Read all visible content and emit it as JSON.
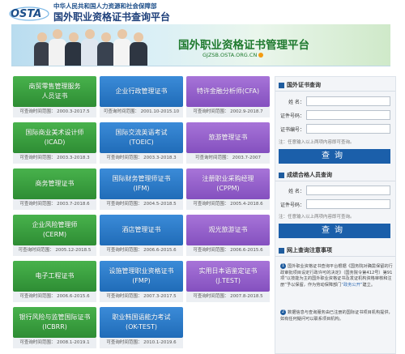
{
  "header": {
    "logo_text": "OSTA",
    "ministry": "中华人民共和国人力资源和社会保障部",
    "site_title": "国外职业资格证书查询平台"
  },
  "banner": {
    "title": "国外职业资格证书管理平台",
    "url": "GJZSB.OSTA.ORG.CN"
  },
  "certificates": [
    {
      "name_lines": [
        "商贸零售管理服务",
        "人员证书"
      ],
      "range": "可查询时间范围： 2000.3-2017.5",
      "color": "green"
    },
    {
      "name_lines": [
        "企业行政管理证书"
      ],
      "range": "可查询时间范围： 2001.10-2015.10",
      "color": "blue"
    },
    {
      "name_lines": [
        "特许金融分析师(CFA)"
      ],
      "range": "可查询时间范围： 2002.9-2018.7",
      "color": "purple"
    },
    {
      "name_lines": [
        "国际商业美术设计师",
        "(ICAD)"
      ],
      "range": "可查询时间范围： 2003.3-2018.3",
      "color": "green"
    },
    {
      "name_lines": [
        "国际交流英语考试",
        "(TOEIC)"
      ],
      "range": "可查询时间范围： 2003.3-2018.3",
      "color": "blue"
    },
    {
      "name_lines": [
        "旅游管理证书"
      ],
      "range": "可查询时间范围： 2003.7-2007",
      "color": "purple"
    },
    {
      "name_lines": [
        "商务管理证书"
      ],
      "range": "可查询时间范围： 2003.7-2018.6",
      "color": "green"
    },
    {
      "name_lines": [
        "国际财务管理师证书",
        "(IFM)"
      ],
      "range": "可查询时间范围： 2004.5-2018.5",
      "color": "blue"
    },
    {
      "name_lines": [
        "注册职业采购经理",
        "(CPPM)"
      ],
      "range": "可查询时间范围： 2005.4-2018.6",
      "color": "purple"
    },
    {
      "name_lines": [
        "企业风险管理师",
        "(CERM)"
      ],
      "range": "可查询时间范围： 2005.12-2018.5",
      "color": "green"
    },
    {
      "name_lines": [
        "酒店管理证书"
      ],
      "range": "可查询时间范围： 2006.6-2015.6",
      "color": "blue"
    },
    {
      "name_lines": [
        "观光旅游证书"
      ],
      "range": "可查询时间范围： 2006.6-2015.6",
      "color": "purple"
    },
    {
      "name_lines": [
        "电子工程证书"
      ],
      "range": "可查询时间范围： 2006.6-2015.6",
      "color": "green"
    },
    {
      "name_lines": [
        "设施管理职业资格证书",
        "(FMP)"
      ],
      "range": "可查询时间范围： 2007.3-2017.5",
      "color": "blue"
    },
    {
      "name_lines": [
        "实用日本语鉴定证书",
        "(J.TEST)"
      ],
      "range": "可查询时间范围： 2007.8-2018.5",
      "color": "purple"
    },
    {
      "name_lines": [
        "银行风险与监管国际证书",
        "(ICBRR)"
      ],
      "range": "可查询时间范围： 2008.1-2019.1",
      "color": "green"
    },
    {
      "name_lines": [
        "职业韩国语能力考试",
        "(OK-TEST)"
      ],
      "range": "可查询时间范围： 2010.1-2019.6",
      "color": "blue"
    }
  ],
  "cert_query": {
    "heading": "国外证书查询",
    "name_label": "姓    名：",
    "id_label": "证件号码：",
    "cert_label": "证书编号：",
    "note": "注：任意输入以上两项内容即可查询。",
    "button": "查询"
  },
  "score_query": {
    "heading": "成绩合格人员查询",
    "name_label": "姓    名：",
    "id_label": "证件号码：",
    "note": "注：任意输入以上两项内容即可查询。",
    "button": "查询"
  },
  "notice": {
    "heading": "网上查询注意事项",
    "item1_num": "1",
    "item1_text": "国外职业资格证书查询平台根据《国务院对确需保留的行政审批项目设定行政许可的决定》（国务院令第412号）第91项“以技能为主的国外职业资格证书及发证机构资格审核和注册”予以保留，作为劳动保障部门",
    "item1_link": "“政务公开”",
    "item1_tail": "建立。",
    "item2_num": "2",
    "item2_text": "数据信息与查询服务由已注册的国际证书项目机构提供，如有任何疑问可以联系项目机构。"
  },
  "colors": {
    "green": "#3aa040",
    "blue": "#2b7bc8",
    "purple": "#9562cc",
    "query_button": "#1b5faa",
    "title_green": "#1f7a2e"
  }
}
